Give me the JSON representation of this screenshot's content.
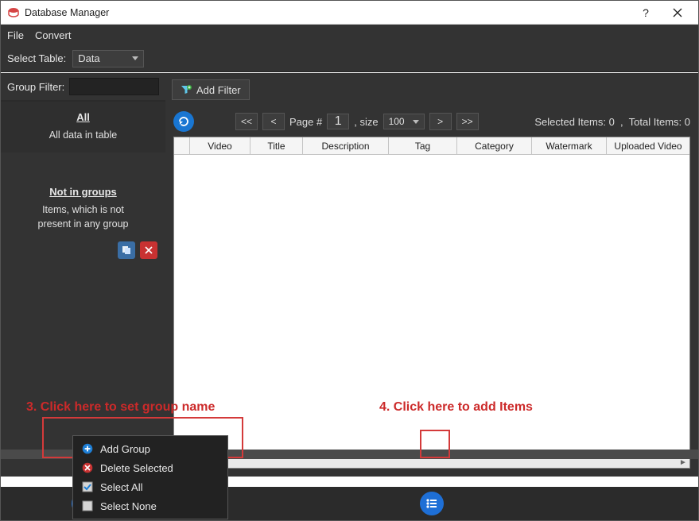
{
  "window": {
    "title": "Database Manager"
  },
  "menubar": {
    "file": "File",
    "convert": "Convert"
  },
  "tablebar": {
    "label": "Select Table:",
    "selected": "Data"
  },
  "sidebar": {
    "filter_label": "Group Filter:",
    "group_all": {
      "title": "All",
      "desc": "All data in table"
    },
    "group_not": {
      "title": "Not in groups",
      "desc_line1": "Items, which is not",
      "desc_line2": "present in any group"
    }
  },
  "filterbar": {
    "add_filter": "Add Filter"
  },
  "pager": {
    "first": "<<",
    "prev": "<",
    "next": ">",
    "last": ">>",
    "page_label": "Page #",
    "page_value": "1",
    "size_label": ", size",
    "size_value": "100"
  },
  "status": {
    "selected_label": "Selected Items:",
    "selected_value": "0",
    "sep": ",",
    "total_label": "Total Items:",
    "total_value": "0"
  },
  "table": {
    "columns": [
      "Video",
      "Title",
      "Description",
      "Tag",
      "Category",
      "Watermark",
      "Uploaded Video"
    ]
  },
  "context_menu": {
    "add_group": "Add Group",
    "delete_selected": "Delete Selected",
    "select_all": "Select All",
    "select_none": "Select None"
  },
  "annotations": {
    "step3": "3. Click here to set group name",
    "step4": "4. Click here to add Items"
  }
}
